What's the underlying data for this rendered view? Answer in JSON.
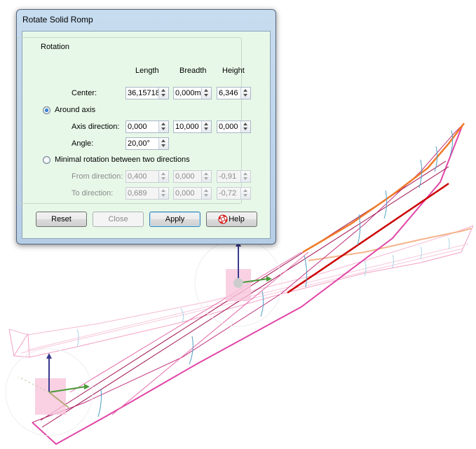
{
  "dialog": {
    "title": "Rotate Solid Romp",
    "group_label": "Rotation",
    "columns": [
      "Length",
      "Breadth",
      "Height"
    ],
    "center": {
      "label": "Center:",
      "values": [
        "36,15718",
        "0,000m",
        "6,346"
      ]
    },
    "around_axis": {
      "label": "Around axis",
      "checked": true,
      "axis_direction": {
        "label": "Axis direction:",
        "values": [
          "0,000",
          "10,000",
          "0,000"
        ]
      },
      "angle": {
        "label": "Angle:",
        "value": "20,00°"
      }
    },
    "minimal_rotation": {
      "label": "Minimal rotation between two directions",
      "checked": false,
      "from_direction": {
        "label": "From direction:",
        "values": [
          "0,400",
          "0,000",
          "-0,91"
        ]
      },
      "to_direction": {
        "label": "To direction:",
        "values": [
          "0,689",
          "0,000",
          "-0,72"
        ]
      }
    },
    "buttons": {
      "reset": "Reset",
      "close": "Close",
      "apply": "Apply",
      "help": "Help"
    }
  },
  "colors": {
    "dialog_client": "#e8f8e8",
    "hull_original": "#e46aa8",
    "hull_rotated": "#d5007a",
    "keel_highlight": "#cc0000",
    "sheer_line": "#f07a28",
    "station_lines": "#5fa8c8",
    "axis_z": "#3a3a8f",
    "axis_x": "#4a9a3a"
  }
}
